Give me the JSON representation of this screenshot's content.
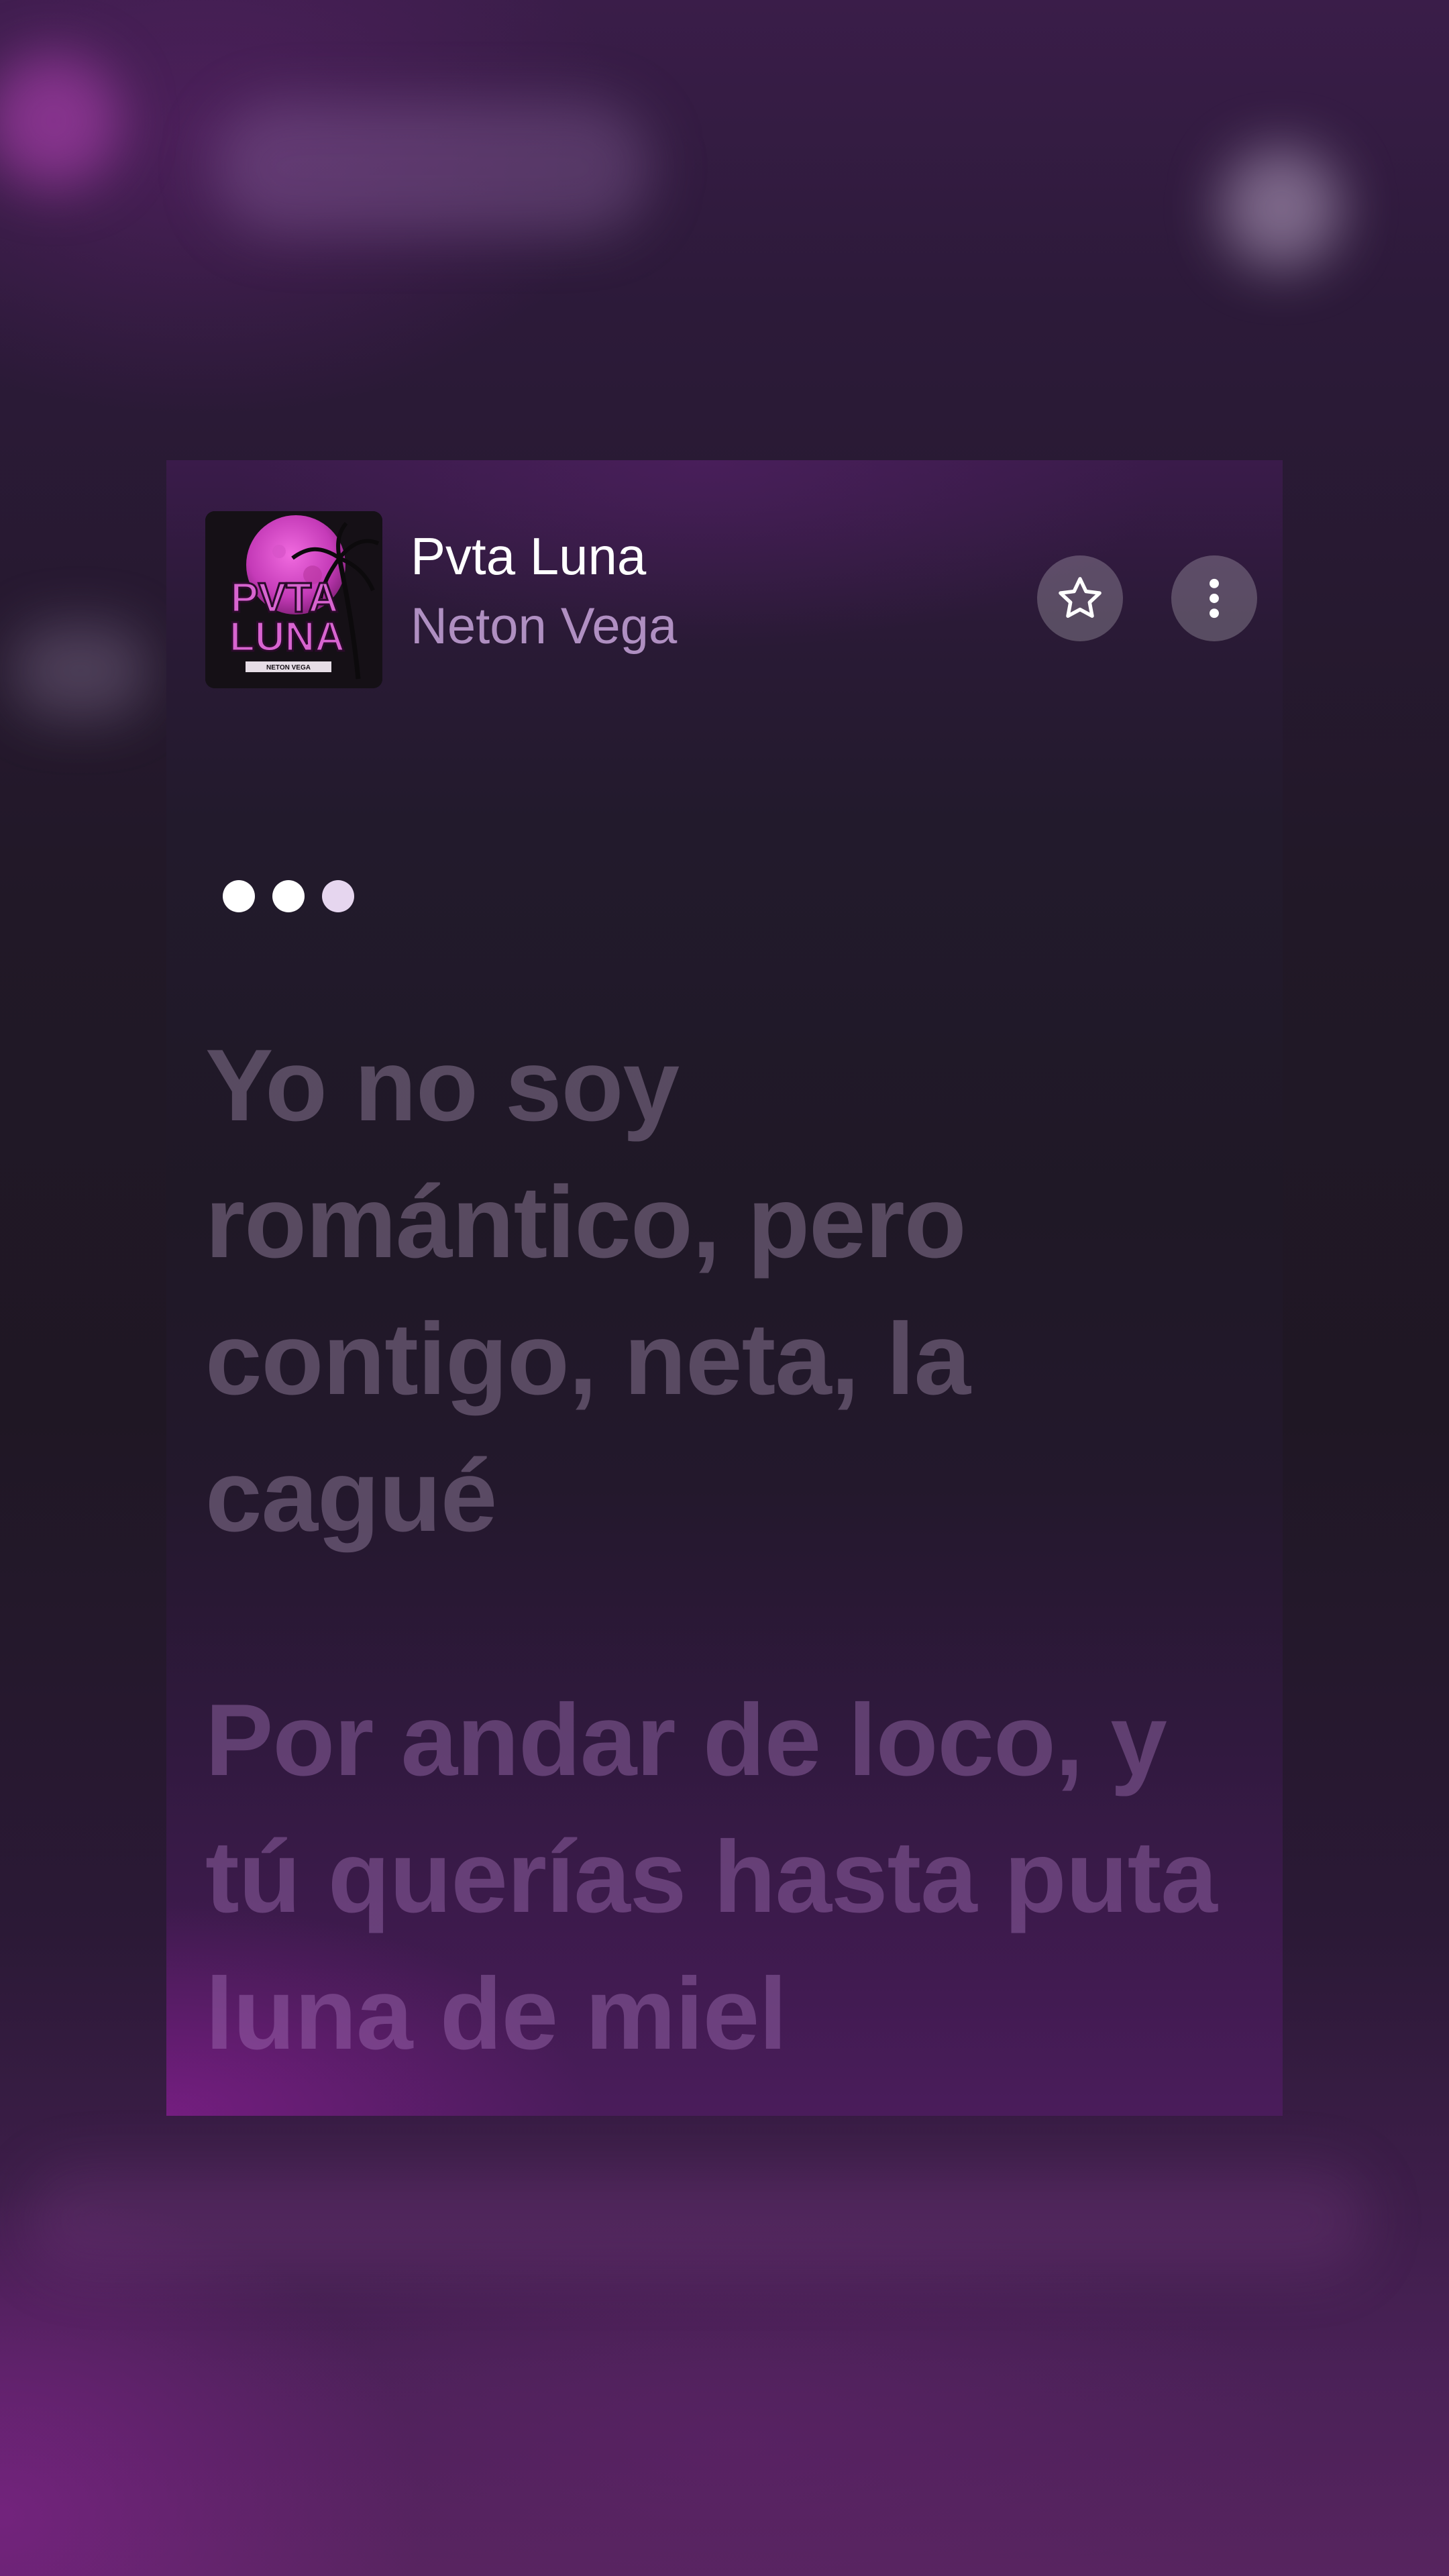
{
  "now_playing": {
    "title": "Pvta Luna",
    "artist": "Neton Vega",
    "artwork": {
      "text_line_1": "PVTA",
      "text_line_2": "LUNA",
      "subtitle": "NETON VEGA"
    }
  },
  "controls": {
    "favorite_icon": "star-outline-icon",
    "more_icon": "vertical-ellipsis-icon"
  },
  "lyrics": {
    "instrumental_indicator_dots": 3,
    "lines": [
      "Yo no soy romántico, pero contigo, neta, la cagué",
      "Por andar de loco, y tú querías hasta puta luna de miel"
    ]
  },
  "colors": {
    "accent_purple": "#7b2a86",
    "panel_top": "#3a1b4a",
    "lyric_dim": "#8f8199"
  }
}
